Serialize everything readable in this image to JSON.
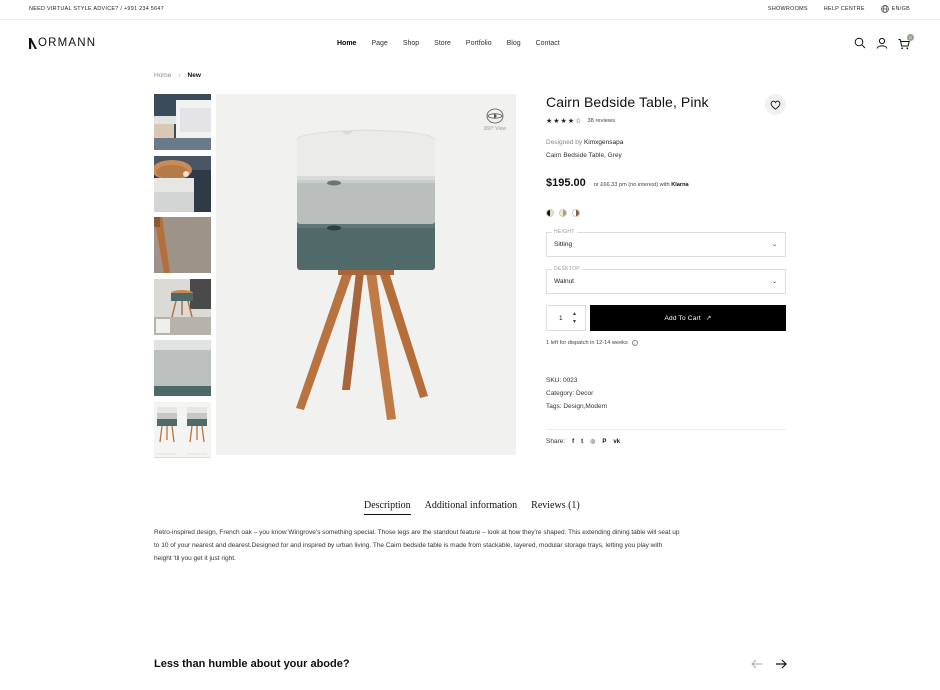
{
  "topbar": {
    "advice": "NEED VIRTUAL STYLE ADVICE? / +991 234 5647",
    "showrooms": "SHOWROOMS",
    "help": "HELP CENTRE",
    "language": "EN/GB"
  },
  "header": {
    "logo": "ORMANN",
    "nav": [
      "Home",
      "Page",
      "Shop",
      "Store",
      "Portfolio",
      "Blog",
      "Contact"
    ],
    "active_nav": "Home",
    "cart_count": "0"
  },
  "breadcrumb": {
    "home": "Home",
    "current": "New"
  },
  "gallery": {
    "view_label": "360° View",
    "thumbnail_icons": [
      "thumb-bedside-bed-image",
      "thumb-table-top-image",
      "thumb-leg-detail-image",
      "thumb-room-image",
      "thumb-drawer-detail-image",
      "thumb-pair-image"
    ]
  },
  "product": {
    "title": "Cairn Bedside Table, Pink",
    "rating": 4,
    "stars": "★★★★☆",
    "reviews": "38 reviews",
    "designed_by_label": "Designed by",
    "designer": "Kimxgensapa",
    "subname": "Cairn Bedside Table, Grey",
    "price": "$195.00",
    "klarna_text": "or £66.33 pm (no interest) with",
    "klarna_brand": "Klarna",
    "swatch_colors": [
      [
        "#111111",
        "#e8dcc0"
      ],
      [
        "#f3e7cc",
        "#b89a6a"
      ],
      [
        "#ffffff",
        "#8a5a3a"
      ]
    ]
  },
  "options": {
    "height_label": "HEIGHT",
    "height_value": "Sitting",
    "desktop_label": "DESKTOP",
    "desktop_value": "Walnut"
  },
  "cart": {
    "quantity": "1",
    "add_label": "Add To Cart",
    "dispatch": "1 left for dispatch in 12-14 weeks"
  },
  "meta": {
    "sku": "SKU: 0023",
    "category": "Category: Decor",
    "tags": "Tags: Design,Modern"
  },
  "share": {
    "label": "Share:",
    "icons": [
      "facebook-icon",
      "twitter-icon",
      "instagram-icon",
      "pinterest-icon",
      "vk-icon"
    ]
  },
  "tabs": {
    "description": "Description",
    "additional": "Additional information",
    "reviews": "Reviews (1)"
  },
  "description": {
    "line1": "Retro-inspired design, French oak – you know Wingrove's something special. Those legs are the standout feature – look at how they're shaped. This extending dining table will seat up",
    "line2": "to 10 of your nearest and dearest.Designed for and inspired by urban living. The Cairn bedside table is made from stackable, layered, modular storage trays, letting you play with",
    "line3": "height 'til you get it just right."
  },
  "footer_section": {
    "heading": "Less than humble about your abode?"
  },
  "colors": {
    "accent_badge": "#8da88c",
    "tray_white": "#ebebea",
    "tray_grey": "#b9bfbc",
    "tray_teal": "#4f6a69",
    "wood": "#b9733f"
  }
}
